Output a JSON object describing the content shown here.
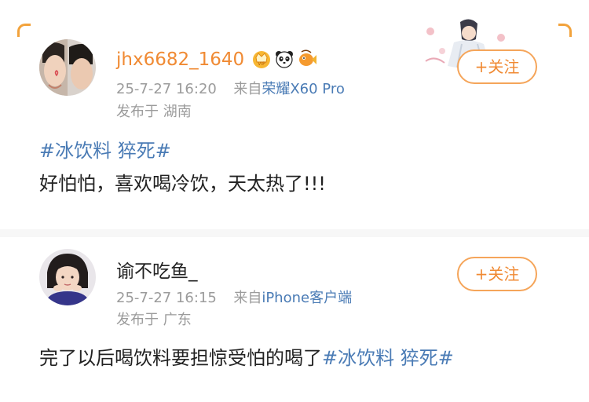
{
  "colors": {
    "accent_orange": "#f08a33",
    "link_blue": "#4a7bb5",
    "username_orange": "#f08a33",
    "meta_gray": "#9b9b9b",
    "body_text": "#222222"
  },
  "posts": [
    {
      "username": "jhx6682_1640",
      "badges": [
        "crown-badge-icon",
        "panda-icon",
        "fish-icon"
      ],
      "time": "25-7-27 16:20",
      "source_prefix": "来自",
      "device": "荣耀X60 Pro",
      "location": "发布于 湖南",
      "follow_label": "+关注",
      "topic": "#冰饮料 猝死#",
      "text": "好怕怕，喜欢喝冷饮，天太热了!!!"
    },
    {
      "username": "谕不吃鱼_",
      "time": "25-7-27 16:15",
      "source_prefix": "来自",
      "device": "iPhone客户端",
      "location": "发布于 广东",
      "follow_label": "+关注",
      "text": "完了以后喝饮料要担惊受怕的喝了",
      "topic": "#冰饮料 猝死#"
    }
  ]
}
